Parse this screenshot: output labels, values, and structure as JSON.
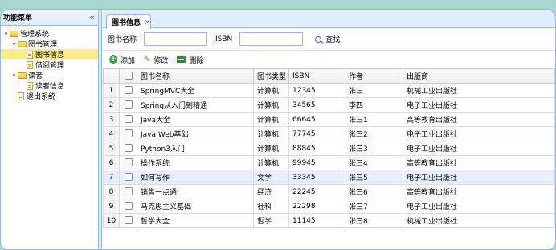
{
  "sidebar": {
    "title": "功能菜单",
    "collapse_glyph": "«",
    "tree": [
      {
        "label": "管理系统"
      },
      {
        "label": "图书管理"
      },
      {
        "label": "图书信息"
      },
      {
        "label": "借阅管理"
      },
      {
        "label": "读者"
      },
      {
        "label": "读者信息"
      },
      {
        "label": "退出系统"
      }
    ]
  },
  "tab": {
    "label": "图书信息",
    "close": "×"
  },
  "search": {
    "name_label": "图书名称",
    "name_value": "",
    "isbn_label": "ISBN",
    "isbn_value": "",
    "search_label": "查找"
  },
  "toolbar": {
    "add_label": "添加",
    "edit_label": "修改",
    "delete_label": "删除"
  },
  "grid": {
    "columns": [
      "图书名称",
      "图书类型",
      "ISBN",
      "作者",
      "出版商"
    ],
    "rows": [
      [
        "1",
        "SpringMVC大全",
        "计算机",
        "12345",
        "张三",
        "机械工业出版社"
      ],
      [
        "2",
        "Spring从入门到精通",
        "计算机",
        "34565",
        "李四",
        "电子工业出版社"
      ],
      [
        "3",
        "Java大全",
        "计算机",
        "66645",
        "张三1",
        "高等教育出版社"
      ],
      [
        "4",
        "Java Web基础",
        "计算机",
        "77745",
        "张三2",
        "电子工业出版社"
      ],
      [
        "5",
        "Python3入门",
        "计算机",
        "88845",
        "张三3",
        "电子工业出版社"
      ],
      [
        "6",
        "操作系统",
        "计算机",
        "99945",
        "张三4",
        "高等教育出版社"
      ],
      [
        "7",
        "如何写作",
        "文学",
        "33345",
        "张三5",
        "电子工业出版社"
      ],
      [
        "8",
        "销售一点通",
        "经济",
        "22245",
        "张三6",
        "高等教育出版社"
      ],
      [
        "9",
        "马克思主义基础",
        "社科",
        "22298",
        "张三7",
        "电子工业出版社"
      ],
      [
        "10",
        "哲学大全",
        "哲学",
        "11145",
        "张三8",
        "机械工业出版社"
      ]
    ],
    "highlight_row": 7
  },
  "colors": {
    "accent_border": "#95b8e7",
    "selected_node": "#fbec88",
    "row_highlight": "#e6efff"
  }
}
